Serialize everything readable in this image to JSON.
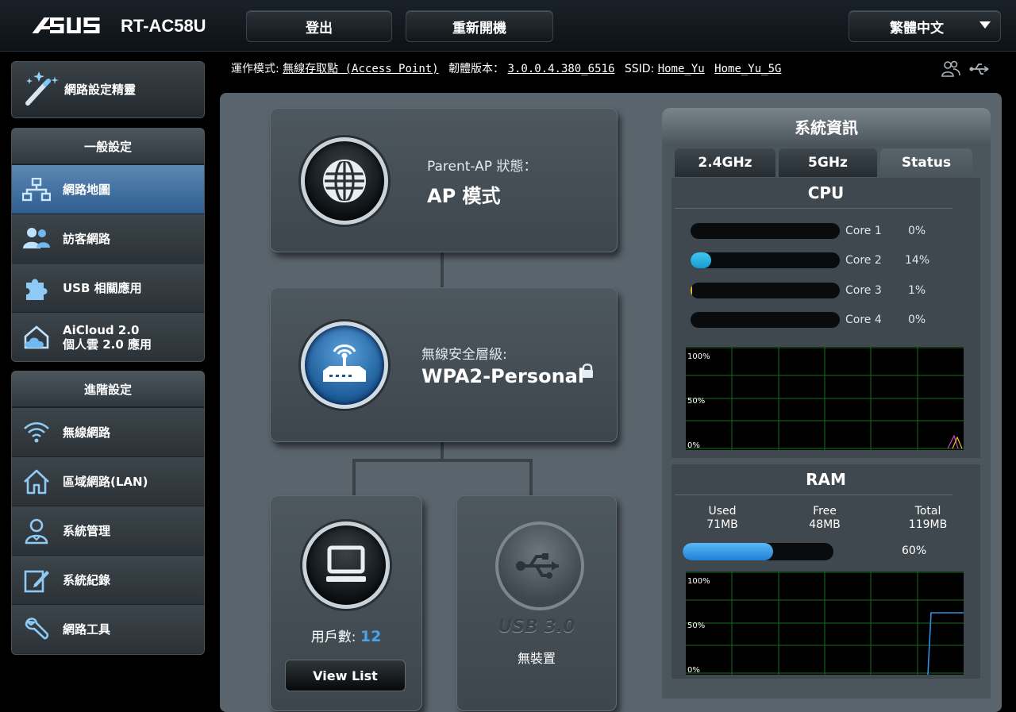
{
  "header": {
    "brand": "/ISUS",
    "model": "RT-AC58U",
    "logout_label": "登出",
    "reboot_label": "重新開機",
    "language": "繁體中文"
  },
  "status_line": {
    "mode_label": "運作模式:",
    "mode_value": "無線存取點 (Access Point)",
    "firmware_label": "韌體版本：",
    "firmware_value": "3.0.0.4.380_6516",
    "ssid_label": "SSID:",
    "ssid_1": "Home_Yu",
    "ssid_2": "Home_Yu_5G"
  },
  "sidebar": {
    "wizard_label": "網路設定精靈",
    "general_header": "一般設定",
    "general_items": [
      {
        "label": "網路地圖"
      },
      {
        "label": "訪客網路"
      },
      {
        "label": "USB 相關應用"
      },
      {
        "label": "AiCloud 2.0",
        "label2": "個人雲 2.0 應用"
      }
    ],
    "advanced_header": "進階設定",
    "advanced_items": [
      {
        "label": "無線網路"
      },
      {
        "label": "區域網路(LAN)"
      },
      {
        "label": "系統管理"
      },
      {
        "label": "系統紀錄"
      },
      {
        "label": "網路工具"
      }
    ]
  },
  "network_map": {
    "parent_ap_label": "Parent-AP 狀態：",
    "parent_ap_value": "AP 模式",
    "security_label": "無線安全層級:",
    "security_value": "WPA2-Personal",
    "clients_label": "用戶數:",
    "clients_count": "12",
    "view_list_label": "View List",
    "usb_label": "USB 3.0",
    "usb_status": "無裝置"
  },
  "system_info": {
    "title": "系統資訊",
    "tabs": [
      "2.4GHz",
      "5GHz",
      "Status"
    ],
    "active_tab": "Status",
    "cpu_title": "CPU",
    "cores": [
      {
        "name": "Core 1",
        "percent": "0%",
        "value": 0,
        "color": "#3ec8f0"
      },
      {
        "name": "Core 2",
        "percent": "14%",
        "value": 14,
        "color": "#3ec8f0"
      },
      {
        "name": "Core 3",
        "percent": "1%",
        "value": 1,
        "color": "#e8c020"
      },
      {
        "name": "Core 4",
        "percent": "0%",
        "value": 0,
        "color": "#3ec8f0"
      }
    ],
    "graph_labels": [
      "100%",
      "50%",
      "0%"
    ],
    "ram_title": "RAM",
    "ram": {
      "used_label": "Used",
      "used_value": "71MB",
      "free_label": "Free",
      "free_value": "48MB",
      "total_label": "Total",
      "total_value": "119MB",
      "percent": "60%",
      "value": 60
    }
  },
  "colors": {
    "accent_blue": "#2f8fe0",
    "clients_count": "#4aa3e8"
  }
}
